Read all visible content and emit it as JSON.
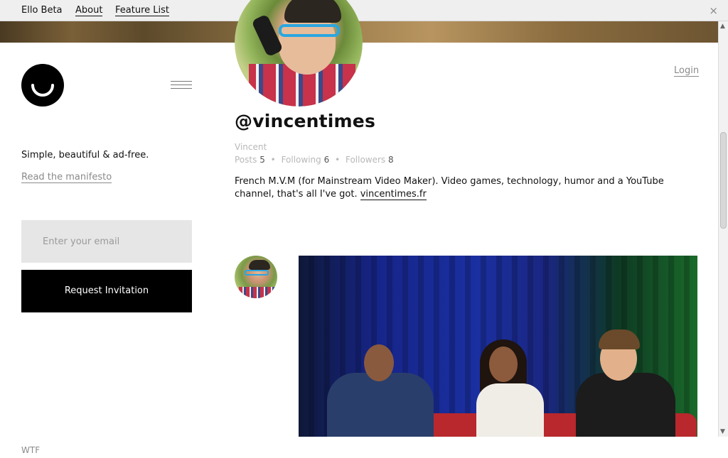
{
  "topbar": {
    "brand": "Ello Beta",
    "links": [
      {
        "label": "About"
      },
      {
        "label": "Feature List"
      }
    ],
    "close_glyph": "×"
  },
  "sidebar": {
    "tagline": "Simple, beautiful & ad-free.",
    "manifesto_link": "Read the manifesto",
    "email_placeholder": "Enter your email",
    "request_button": "Request Invitation",
    "footer_link": "WTF"
  },
  "header": {
    "login": "Login"
  },
  "profile": {
    "username": "@vincentimes",
    "name": "Vincent",
    "stats": {
      "posts_label": "Posts",
      "posts": "5",
      "following_label": "Following",
      "following": "6",
      "followers_label": "Followers",
      "followers": "8"
    },
    "bio": "French M.V.M (for Mainstream Video Maker). Video games, technology, humor and a YouTube channel, that's all I've got.",
    "website": "vincentimes.fr"
  },
  "icons": {
    "logo": "ello-smile-icon",
    "menu": "hamburger-menu-icon",
    "close": "close-icon"
  },
  "colors": {
    "accent": "#000000",
    "muted": "#8a8a8a",
    "input_bg": "#e6e6e6"
  }
}
